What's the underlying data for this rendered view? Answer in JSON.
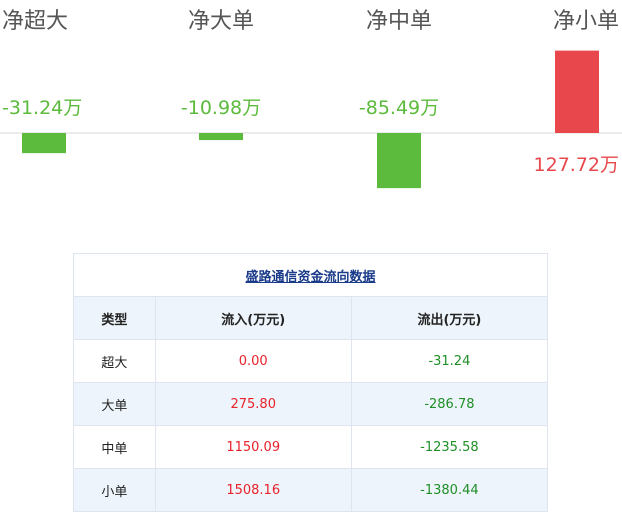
{
  "chart_data": {
    "type": "bar",
    "categories": [
      "净超大",
      "净大单",
      "净中单",
      "净小单"
    ],
    "values": [
      -31.24,
      -10.98,
      -85.49,
      127.72
    ],
    "value_labels": [
      "-31.24万",
      "-10.98万",
      "-85.49万",
      "127.72万"
    ],
    "unit": "万",
    "colors": {
      "positive": "#e8474c",
      "negative": "#5cba3c"
    }
  },
  "table": {
    "title": "盛路通信资金流向数据",
    "headers": [
      "类型",
      "流入(万元)",
      "流出(万元)"
    ],
    "rows": [
      {
        "type": "超大",
        "inflow": "0.00",
        "outflow": "-31.24"
      },
      {
        "type": "大单",
        "inflow": "275.80",
        "outflow": "-286.78"
      },
      {
        "type": "中单",
        "inflow": "1150.09",
        "outflow": "-1235.58"
      },
      {
        "type": "小单",
        "inflow": "1508.16",
        "outflow": "-1380.44"
      }
    ]
  },
  "colors": {
    "inflow": "#e8222b",
    "outflow": "#1f8f27",
    "header_bg": "#eef4fb",
    "title_link": "#1a3a8a"
  }
}
